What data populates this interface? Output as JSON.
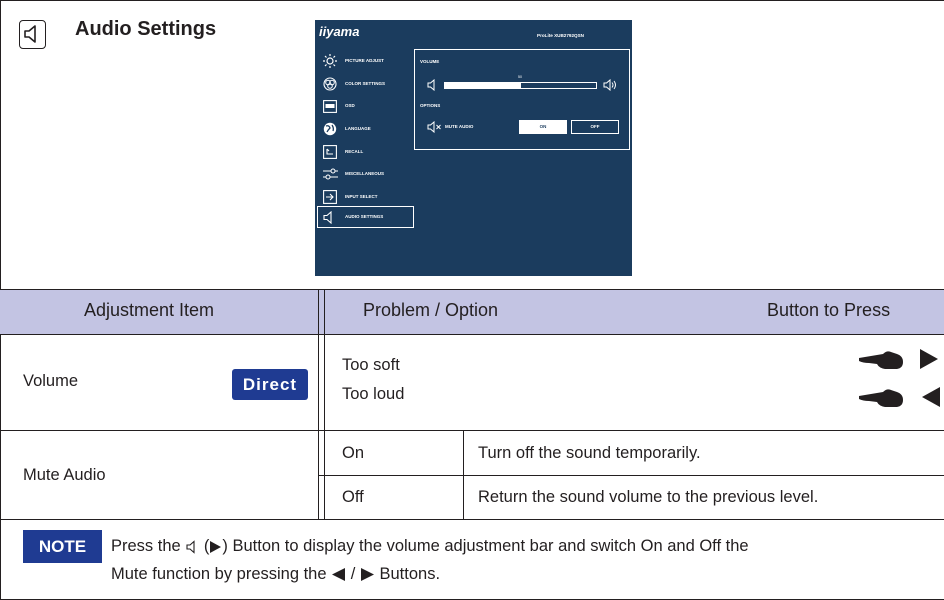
{
  "section": {
    "title": "Audio Settings",
    "icon": "speaker-icon"
  },
  "osd": {
    "brand": "iiyama",
    "model": "ProLite XUB2792QSN",
    "menu": [
      {
        "label": "PICTURE ADJUST",
        "icon": "brightness-icon"
      },
      {
        "label": "COLOR SETTINGS",
        "icon": "color-circles-icon"
      },
      {
        "label": "OSD",
        "icon": "osd-icon"
      },
      {
        "label": "LANGUAGE",
        "icon": "globe-icon"
      },
      {
        "label": "RECALL",
        "icon": "recall-icon"
      },
      {
        "label": "MISCELLANEOUS",
        "icon": "sliders-icon"
      },
      {
        "label": "INPUT SELECT",
        "icon": "input-icon"
      },
      {
        "label": "AUDIO SETTINGS",
        "icon": "speaker-icon"
      }
    ],
    "selected_item": "AUDIO SETTINGS",
    "volume": {
      "heading": "VOLUME",
      "value": "50",
      "level": 0.5
    },
    "options": {
      "heading": "OPTIONS",
      "mute_label": "MUTE AUDIO",
      "on": "ON",
      "off": "OFF",
      "selected": "ON"
    },
    "colors": {
      "background": "#1b3c5e",
      "text": "#ffffff"
    }
  },
  "table": {
    "headers": {
      "item": "Adjustment Item",
      "problem": "Problem / Option",
      "button": "Button to Press"
    },
    "rows": {
      "volume": {
        "item": "Volume",
        "badge": "Direct",
        "lines": [
          "Too soft",
          "Too loud"
        ]
      },
      "mute": {
        "item": "Mute Audio",
        "options": [
          {
            "option": "On",
            "description": "Turn off the sound temporarily."
          },
          {
            "option": "Off",
            "description": "Return the sound volume to the previous level."
          }
        ]
      }
    },
    "colors": {
      "header_bg": "#c3c4e3",
      "badge_bg": "#1f3b92"
    }
  },
  "note": {
    "badge": "NOTE",
    "text_1a": "Press the",
    "text_1b": "Button to display the volume adjustment bar and switch On and Off the",
    "text_2a": "Mute function by pressing the",
    "text_2b": "Buttons."
  }
}
